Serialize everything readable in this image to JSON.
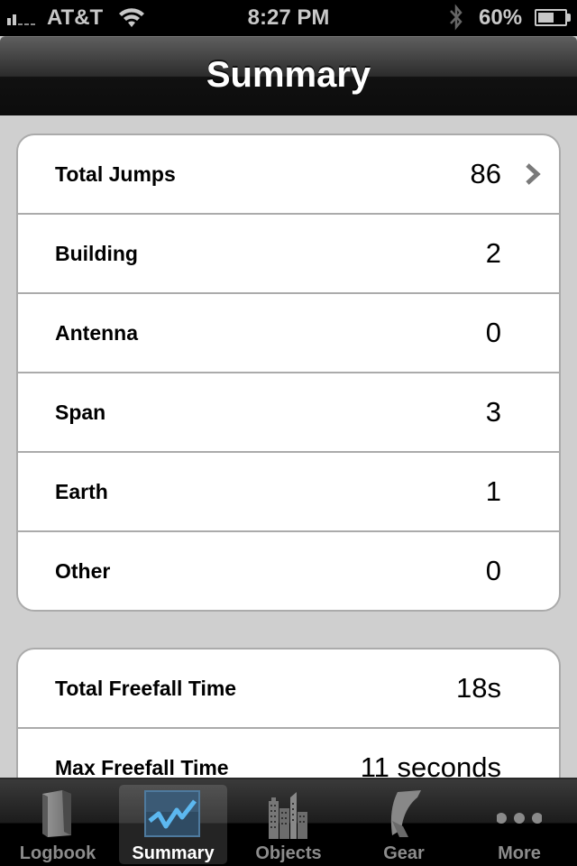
{
  "status_bar": {
    "carrier": "AT&T",
    "time": "8:27 PM",
    "battery_percent_label": "60%",
    "battery_level": 0.6,
    "signal_bars": 2,
    "signal_bars_max": 5,
    "icons": [
      "signal-icon",
      "wifi-icon",
      "bluetooth-icon",
      "battery-icon"
    ]
  },
  "nav": {
    "title": "Summary"
  },
  "jump_counts": {
    "rows": [
      {
        "label": "Total Jumps",
        "value": "86",
        "disclosure": true
      },
      {
        "label": "Building",
        "value": "2"
      },
      {
        "label": "Antenna",
        "value": "0"
      },
      {
        "label": "Span",
        "value": "3"
      },
      {
        "label": "Earth",
        "value": "1"
      },
      {
        "label": "Other",
        "value": "0"
      }
    ]
  },
  "freefall": {
    "rows": [
      {
        "label": "Total Freefall Time",
        "value": "18s"
      },
      {
        "label": "Max Freefall Time",
        "value": "11 seconds"
      }
    ]
  },
  "tab_bar": {
    "active": "Summary",
    "tabs": [
      {
        "label": "Logbook",
        "icon": "logbook-icon"
      },
      {
        "label": "Summary",
        "icon": "chart-icon"
      },
      {
        "label": "Objects",
        "icon": "buildings-icon"
      },
      {
        "label": "Gear",
        "icon": "gear-canopy-icon"
      },
      {
        "label": "More",
        "icon": "more-icon"
      }
    ]
  },
  "colors": {
    "background": "#cfcfcf",
    "card_border": "#ababab",
    "chevron": "#7a7a7a",
    "tab_active_icon": "#4aa8e8"
  }
}
